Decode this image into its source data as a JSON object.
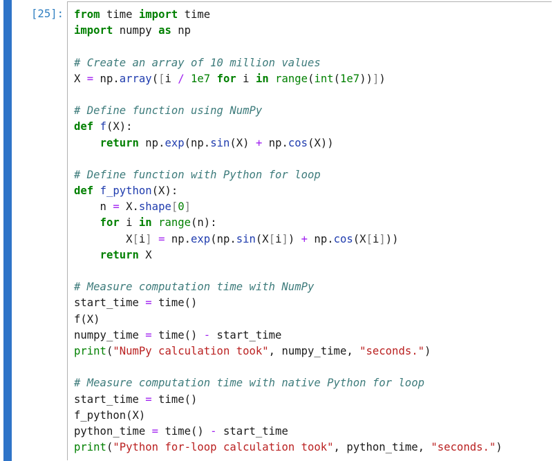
{
  "cell": {
    "prompt": "[25]:",
    "bar_color": "#2f74c8"
  },
  "code": {
    "lines": [
      [
        {
          "t": "from",
          "c": "kw"
        },
        {
          "t": " time ",
          "c": "tx"
        },
        {
          "t": "import",
          "c": "kw"
        },
        {
          "t": " time",
          "c": "tx"
        }
      ],
      [
        {
          "t": "import",
          "c": "kw"
        },
        {
          "t": " numpy ",
          "c": "tx"
        },
        {
          "t": "as",
          "c": "kw"
        },
        {
          "t": " np",
          "c": "tx"
        }
      ],
      [],
      [
        {
          "t": "# Create an array of 10 million values",
          "c": "cm"
        }
      ],
      [
        {
          "t": "X ",
          "c": "tx"
        },
        {
          "t": "=",
          "c": "op"
        },
        {
          "t": " np.",
          "c": "tx"
        },
        {
          "t": "array",
          "c": "at"
        },
        {
          "t": "(",
          "c": "tx"
        },
        {
          "t": "[",
          "c": "br"
        },
        {
          "t": "i ",
          "c": "tx"
        },
        {
          "t": "/",
          "c": "op"
        },
        {
          "t": " ",
          "c": "tx"
        },
        {
          "t": "1e7",
          "c": "num"
        },
        {
          "t": " ",
          "c": "tx"
        },
        {
          "t": "for",
          "c": "kw"
        },
        {
          "t": " i ",
          "c": "tx"
        },
        {
          "t": "in",
          "c": "kw"
        },
        {
          "t": " ",
          "c": "tx"
        },
        {
          "t": "range",
          "c": "bi"
        },
        {
          "t": "(",
          "c": "tx"
        },
        {
          "t": "int",
          "c": "bi"
        },
        {
          "t": "(",
          "c": "tx"
        },
        {
          "t": "1e7",
          "c": "num"
        },
        {
          "t": "))",
          "c": "tx"
        },
        {
          "t": "]",
          "c": "br"
        },
        {
          "t": ")",
          "c": "tx"
        }
      ],
      [],
      [
        {
          "t": "# Define function using NumPy",
          "c": "cm"
        }
      ],
      [
        {
          "t": "def",
          "c": "kw"
        },
        {
          "t": " ",
          "c": "tx"
        },
        {
          "t": "f",
          "c": "at"
        },
        {
          "t": "(X):",
          "c": "tx"
        }
      ],
      [
        {
          "t": "    ",
          "c": "tx"
        },
        {
          "t": "return",
          "c": "kw"
        },
        {
          "t": " np.",
          "c": "tx"
        },
        {
          "t": "exp",
          "c": "at"
        },
        {
          "t": "(np.",
          "c": "tx"
        },
        {
          "t": "sin",
          "c": "at"
        },
        {
          "t": "(X) ",
          "c": "tx"
        },
        {
          "t": "+",
          "c": "op"
        },
        {
          "t": " np.",
          "c": "tx"
        },
        {
          "t": "cos",
          "c": "at"
        },
        {
          "t": "(X))",
          "c": "tx"
        }
      ],
      [],
      [
        {
          "t": "# Define function with Python for loop",
          "c": "cm"
        }
      ],
      [
        {
          "t": "def",
          "c": "kw"
        },
        {
          "t": " ",
          "c": "tx"
        },
        {
          "t": "f_python",
          "c": "at"
        },
        {
          "t": "(X):",
          "c": "tx"
        }
      ],
      [
        {
          "t": "    n ",
          "c": "tx"
        },
        {
          "t": "=",
          "c": "op"
        },
        {
          "t": " X.",
          "c": "tx"
        },
        {
          "t": "shape",
          "c": "at"
        },
        {
          "t": "[",
          "c": "br"
        },
        {
          "t": "0",
          "c": "num"
        },
        {
          "t": "]",
          "c": "br"
        }
      ],
      [
        {
          "t": "    ",
          "c": "tx"
        },
        {
          "t": "for",
          "c": "kw"
        },
        {
          "t": " i ",
          "c": "tx"
        },
        {
          "t": "in",
          "c": "kw"
        },
        {
          "t": " ",
          "c": "tx"
        },
        {
          "t": "range",
          "c": "bi"
        },
        {
          "t": "(n):",
          "c": "tx"
        }
      ],
      [
        {
          "t": "        X",
          "c": "tx"
        },
        {
          "t": "[",
          "c": "br"
        },
        {
          "t": "i",
          "c": "tx"
        },
        {
          "t": "]",
          "c": "br"
        },
        {
          "t": " ",
          "c": "tx"
        },
        {
          "t": "=",
          "c": "op"
        },
        {
          "t": " np.",
          "c": "tx"
        },
        {
          "t": "exp",
          "c": "at"
        },
        {
          "t": "(np.",
          "c": "tx"
        },
        {
          "t": "sin",
          "c": "at"
        },
        {
          "t": "(X",
          "c": "tx"
        },
        {
          "t": "[",
          "c": "br"
        },
        {
          "t": "i",
          "c": "tx"
        },
        {
          "t": "]",
          "c": "br"
        },
        {
          "t": ") ",
          "c": "tx"
        },
        {
          "t": "+",
          "c": "op"
        },
        {
          "t": " np.",
          "c": "tx"
        },
        {
          "t": "cos",
          "c": "at"
        },
        {
          "t": "(X",
          "c": "tx"
        },
        {
          "t": "[",
          "c": "br"
        },
        {
          "t": "i",
          "c": "tx"
        },
        {
          "t": "]",
          "c": "br"
        },
        {
          "t": "))",
          "c": "tx"
        }
      ],
      [
        {
          "t": "    ",
          "c": "tx"
        },
        {
          "t": "return",
          "c": "kw"
        },
        {
          "t": " X",
          "c": "tx"
        }
      ],
      [],
      [
        {
          "t": "# Measure computation time with NumPy",
          "c": "cm"
        }
      ],
      [
        {
          "t": "start_time ",
          "c": "tx"
        },
        {
          "t": "=",
          "c": "op"
        },
        {
          "t": " time()",
          "c": "tx"
        }
      ],
      [
        {
          "t": "f(X)",
          "c": "tx"
        }
      ],
      [
        {
          "t": "numpy_time ",
          "c": "tx"
        },
        {
          "t": "=",
          "c": "op"
        },
        {
          "t": " time() ",
          "c": "tx"
        },
        {
          "t": "-",
          "c": "op"
        },
        {
          "t": " start_time",
          "c": "tx"
        }
      ],
      [
        {
          "t": "print",
          "c": "bi"
        },
        {
          "t": "(",
          "c": "tx"
        },
        {
          "t": "\"NumPy calculation took\"",
          "c": "str"
        },
        {
          "t": ", numpy_time, ",
          "c": "tx"
        },
        {
          "t": "\"seconds.\"",
          "c": "str"
        },
        {
          "t": ")",
          "c": "tx"
        }
      ],
      [],
      [
        {
          "t": "# Measure computation time with native Python for loop",
          "c": "cm"
        }
      ],
      [
        {
          "t": "start_time ",
          "c": "tx"
        },
        {
          "t": "=",
          "c": "op"
        },
        {
          "t": " time()",
          "c": "tx"
        }
      ],
      [
        {
          "t": "f_python(X)",
          "c": "tx"
        }
      ],
      [
        {
          "t": "python_time ",
          "c": "tx"
        },
        {
          "t": "=",
          "c": "op"
        },
        {
          "t": " time() ",
          "c": "tx"
        },
        {
          "t": "-",
          "c": "op"
        },
        {
          "t": " start_time",
          "c": "tx"
        }
      ],
      [
        {
          "t": "print",
          "c": "bi"
        },
        {
          "t": "(",
          "c": "tx"
        },
        {
          "t": "\"Python for-loop calculation took\"",
          "c": "str"
        },
        {
          "t": ", python_time, ",
          "c": "tx"
        },
        {
          "t": "\"seconds.\"",
          "c": "str"
        },
        {
          "t": ")",
          "c": "tx"
        }
      ]
    ]
  }
}
